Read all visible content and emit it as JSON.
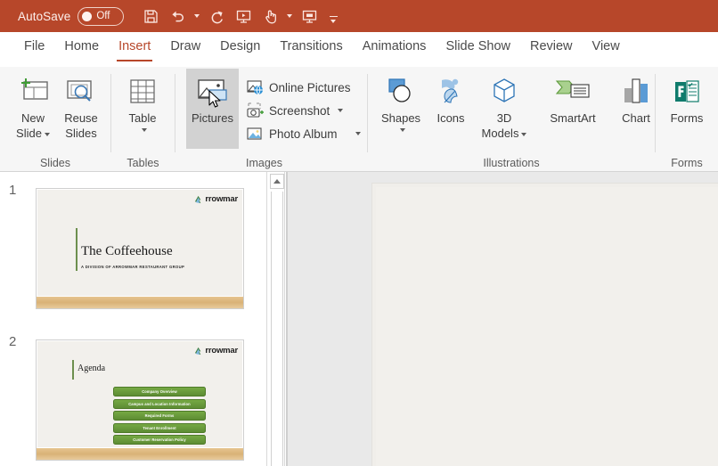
{
  "titlebar": {
    "autosave_label": "AutoSave",
    "autosave_state": "Off",
    "qat": [
      {
        "name": "save-icon",
        "label": "Save"
      },
      {
        "name": "undo-icon",
        "label": "Undo"
      },
      {
        "name": "redo-icon",
        "label": "Redo"
      },
      {
        "name": "start-presentation-icon",
        "label": "Start From Beginning"
      },
      {
        "name": "touch-mouse-mode-icon",
        "label": "Touch/Mouse Mode"
      },
      {
        "name": "present-icon",
        "label": "Present"
      },
      {
        "name": "customize-quick-access-toolbar-icon",
        "label": "Customize Quick Access Toolbar"
      }
    ]
  },
  "tabs": [
    {
      "label": "File",
      "active": false
    },
    {
      "label": "Home",
      "active": false
    },
    {
      "label": "Insert",
      "active": true
    },
    {
      "label": "Draw",
      "active": false
    },
    {
      "label": "Design",
      "active": false
    },
    {
      "label": "Transitions",
      "active": false
    },
    {
      "label": "Animations",
      "active": false
    },
    {
      "label": "Slide Show",
      "active": false
    },
    {
      "label": "Review",
      "active": false
    },
    {
      "label": "View",
      "active": false
    }
  ],
  "ribbon": {
    "groups": {
      "slides": {
        "label": "Slides",
        "new_slide": "New\nSlide",
        "new_slide_line1": "New",
        "new_slide_line2": "Slide",
        "reuse_slides_line1": "Reuse",
        "reuse_slides_line2": "Slides"
      },
      "tables": {
        "label": "Tables",
        "table": "Table"
      },
      "images": {
        "label": "Images",
        "pictures": "Pictures",
        "online_pictures": "Online Pictures",
        "screenshot": "Screenshot",
        "photo_album": "Photo Album"
      },
      "illustrations": {
        "label": "Illustrations",
        "shapes": "Shapes",
        "icons": "Icons",
        "models_line1": "3D",
        "models_line2": "Models",
        "smartart": "SmartArt",
        "chart": "Chart"
      },
      "forms": {
        "label": "Forms",
        "forms": "Forms"
      }
    }
  },
  "thumbnails": [
    {
      "number": "1",
      "logo": "rrowmar",
      "title": "The Coffeehouse",
      "subtitle": "A DIVISION OF ARROWMAR RESTAURANT GROUP"
    },
    {
      "number": "2",
      "logo": "rrowmar",
      "title": "Agenda",
      "agenda": [
        "Company Overview",
        "Campus and Location Information",
        "Required Forms",
        "Tenant Enrollment",
        "Customer Reservation Policy"
      ]
    }
  ],
  "colors": {
    "titlebar": "#b7472a",
    "accent": "#b7472a",
    "ribbon_bg": "#f6f6f6",
    "agenda_green": "#5d8c33",
    "slide_band": "#d9b277"
  }
}
